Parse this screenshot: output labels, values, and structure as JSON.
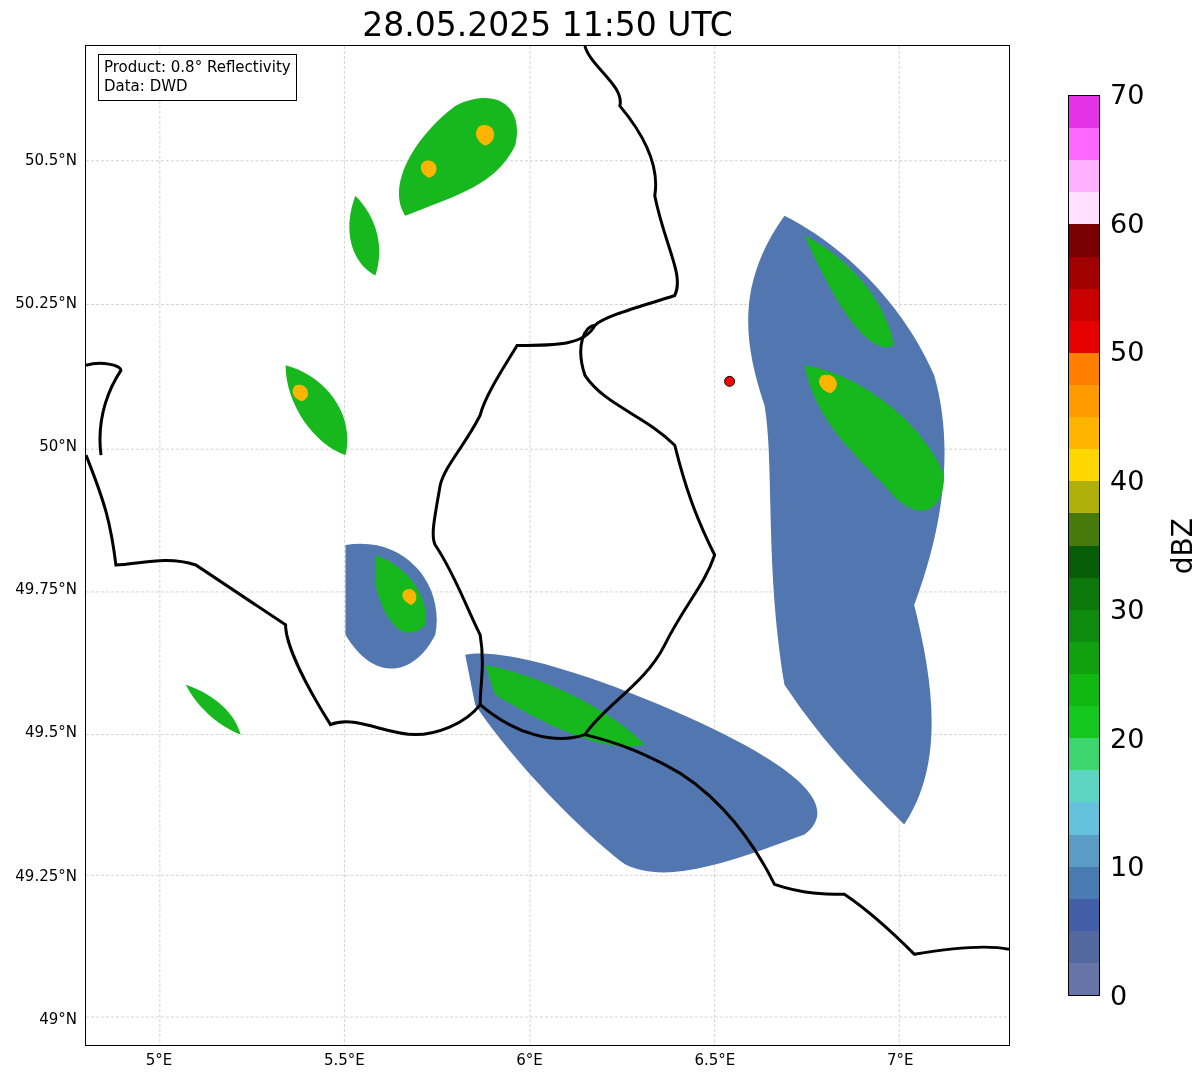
{
  "title": "28.05.2025 11:50 UTC",
  "map": {
    "legend": [
      "Product: 0.8° Reflectivity",
      "Data: DWD"
    ],
    "yticks": [
      "50.5°N",
      "50.25°N",
      "50°N",
      "49.75°N",
      "49.5°N",
      "49.25°N",
      "49°N"
    ],
    "xticks": [
      "5°E",
      "5.5°E",
      "6°E",
      "6.5°E",
      "7°E"
    ]
  },
  "colorbar": {
    "label": "dBZ",
    "ticks": [
      "70",
      "60",
      "50",
      "40",
      "30",
      "20",
      "10",
      "0"
    ],
    "bins": [
      {
        "color": "#6674a8"
      },
      {
        "color": "#5468a0"
      },
      {
        "color": "#425ea6"
      },
      {
        "color": "#4a7ab2"
      },
      {
        "color": "#5a9cc6"
      },
      {
        "color": "#66c2dc"
      },
      {
        "color": "#5cd6c2"
      },
      {
        "color": "#3cd66e"
      },
      {
        "color": "#14c820"
      },
      {
        "color": "#12b812"
      },
      {
        "color": "#10a010"
      },
      {
        "color": "#0e8a0e"
      },
      {
        "color": "#0c780c"
      },
      {
        "color": "#085e08"
      },
      {
        "color": "#467a0a"
      },
      {
        "color": "#b0b00a"
      },
      {
        "color": "#ffd700"
      },
      {
        "color": "#ffb400"
      },
      {
        "color": "#ff9a00"
      },
      {
        "color": "#ff7f00"
      },
      {
        "color": "#e60000"
      },
      {
        "color": "#c80000"
      },
      {
        "color": "#a00000"
      },
      {
        "color": "#780000"
      },
      {
        "color": "#ffe0ff"
      },
      {
        "color": "#ffb0ff"
      },
      {
        "color": "#ff66ff"
      },
      {
        "color": "#e632e6"
      }
    ]
  }
}
